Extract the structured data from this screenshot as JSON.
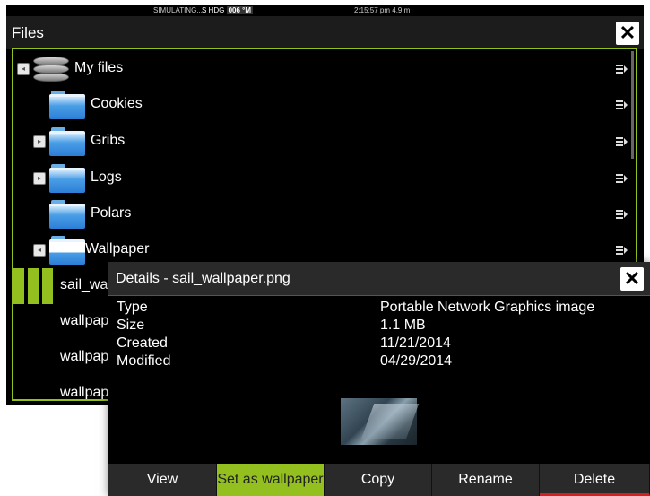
{
  "status_bar": {
    "simulating": "SIMULATING...",
    "hdg_prefix": "S HDG",
    "hdg_value": "006 °M",
    "time": "2:15:57 pm  4.9 m"
  },
  "files": {
    "title": "Files",
    "close_label": "✕",
    "tree": [
      {
        "label": "My files",
        "icon": "database-icon"
      },
      {
        "label": "Cookies",
        "icon": "folder-icon"
      },
      {
        "label": "Gribs",
        "icon": "folder-icon"
      },
      {
        "label": "Logs",
        "icon": "folder-icon"
      },
      {
        "label": "Polars",
        "icon": "folder-icon"
      },
      {
        "label": "Wallpaper",
        "icon": "folder-open-icon"
      }
    ],
    "files_list": [
      {
        "label": "sail_wal"
      },
      {
        "label": "wallpap"
      },
      {
        "label": "wallpap"
      },
      {
        "label": "wallpap"
      }
    ]
  },
  "details": {
    "title": "Details - sail_wallpaper.png",
    "close_label": "✕",
    "properties": [
      {
        "label": "Type",
        "value": "Portable Network Graphics image"
      },
      {
        "label": "Size",
        "value": "1.1 MB"
      },
      {
        "label": "Created",
        "value": "11/21/2014"
      },
      {
        "label": "Modified",
        "value": "04/29/2014"
      }
    ],
    "buttons": {
      "view": "View",
      "set_wallpaper": "Set as wallpaper",
      "copy": "Copy",
      "rename": "Rename",
      "delete": "Delete"
    }
  },
  "colors": {
    "accent": "#93c01f",
    "delete": "#d21f1f"
  }
}
